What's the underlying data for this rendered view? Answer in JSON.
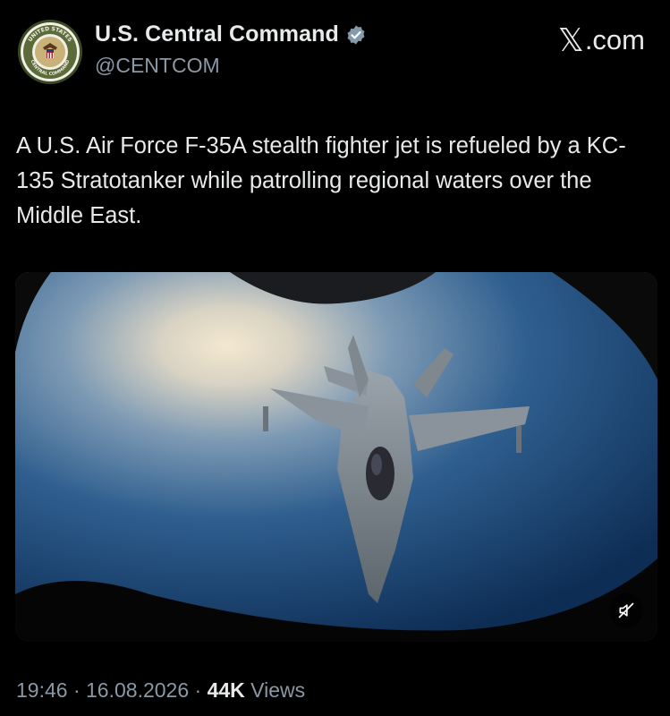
{
  "author": {
    "display_name": "U.S. Central Command",
    "handle": "@CENTCOM",
    "avatar_text_top": "UNITED STATES",
    "avatar_text_bottom": "CENTRAL COMMAND",
    "verified_icon": "verified-badge-icon"
  },
  "brand": {
    "label_x": "𝕏",
    "label_domain": ".com"
  },
  "tweet": {
    "text": "A U.S. Air Force F-35A stealth fighter jet is refueled by a KC-135 Stratotanker while patrolling regional waters over the Middle East."
  },
  "media": {
    "type": "video",
    "mute_icon": "muted-speaker-icon"
  },
  "meta": {
    "time": "19:46",
    "sep1": " · ",
    "date": "16.08.2026",
    "sep2": " · ",
    "views_count": "44K",
    "views_label": " Views"
  },
  "colors": {
    "background": "#000000",
    "text": "#e7e9ea",
    "secondary_text": "#8b98a5",
    "verified": "#829aab"
  }
}
